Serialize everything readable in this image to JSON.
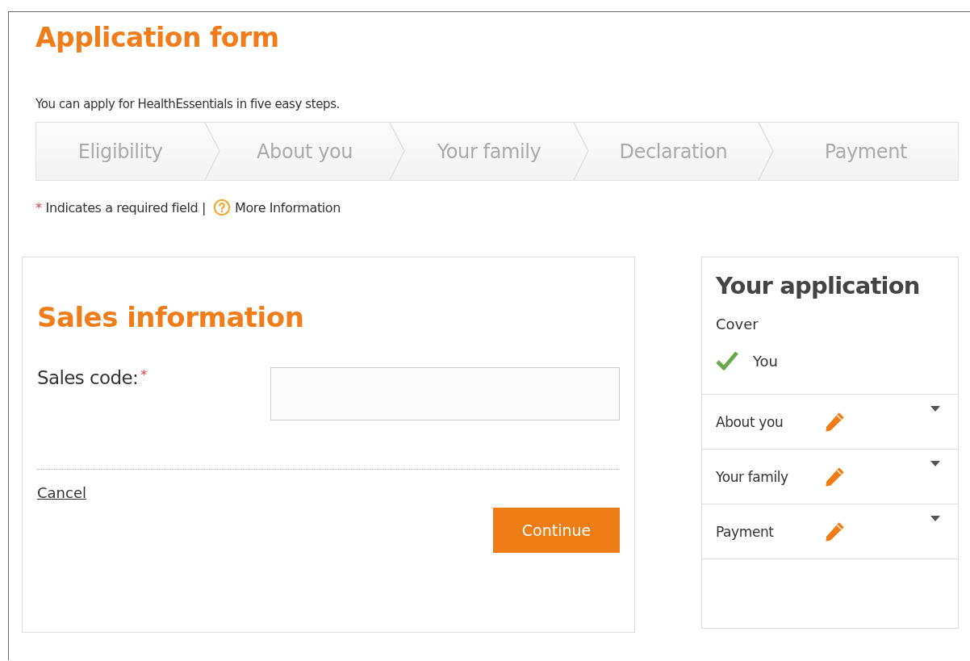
{
  "page": {
    "title": "Application form",
    "intro": "You can apply for HealthEssentials in five easy steps."
  },
  "steps": [
    {
      "label": "Eligibility"
    },
    {
      "label": "About you"
    },
    {
      "label": "Your family"
    },
    {
      "label": "Declaration"
    },
    {
      "label": "Payment"
    }
  ],
  "legend": {
    "required_mark": "*",
    "required_text": "Indicates a required field |",
    "info_link": "More Information"
  },
  "sales_form": {
    "title": "Sales information",
    "field": {
      "label": "Sales code:",
      "required_mark": "*"
    },
    "cancel": "Cancel",
    "submit": "Continue"
  },
  "summary": {
    "title": "Your application",
    "cover_label": "Cover",
    "cover_items": [
      {
        "label": "You",
        "checked": true
      }
    ],
    "sections": [
      {
        "label": "About you"
      },
      {
        "label": "Your family"
      },
      {
        "label": "Payment"
      }
    ]
  }
}
